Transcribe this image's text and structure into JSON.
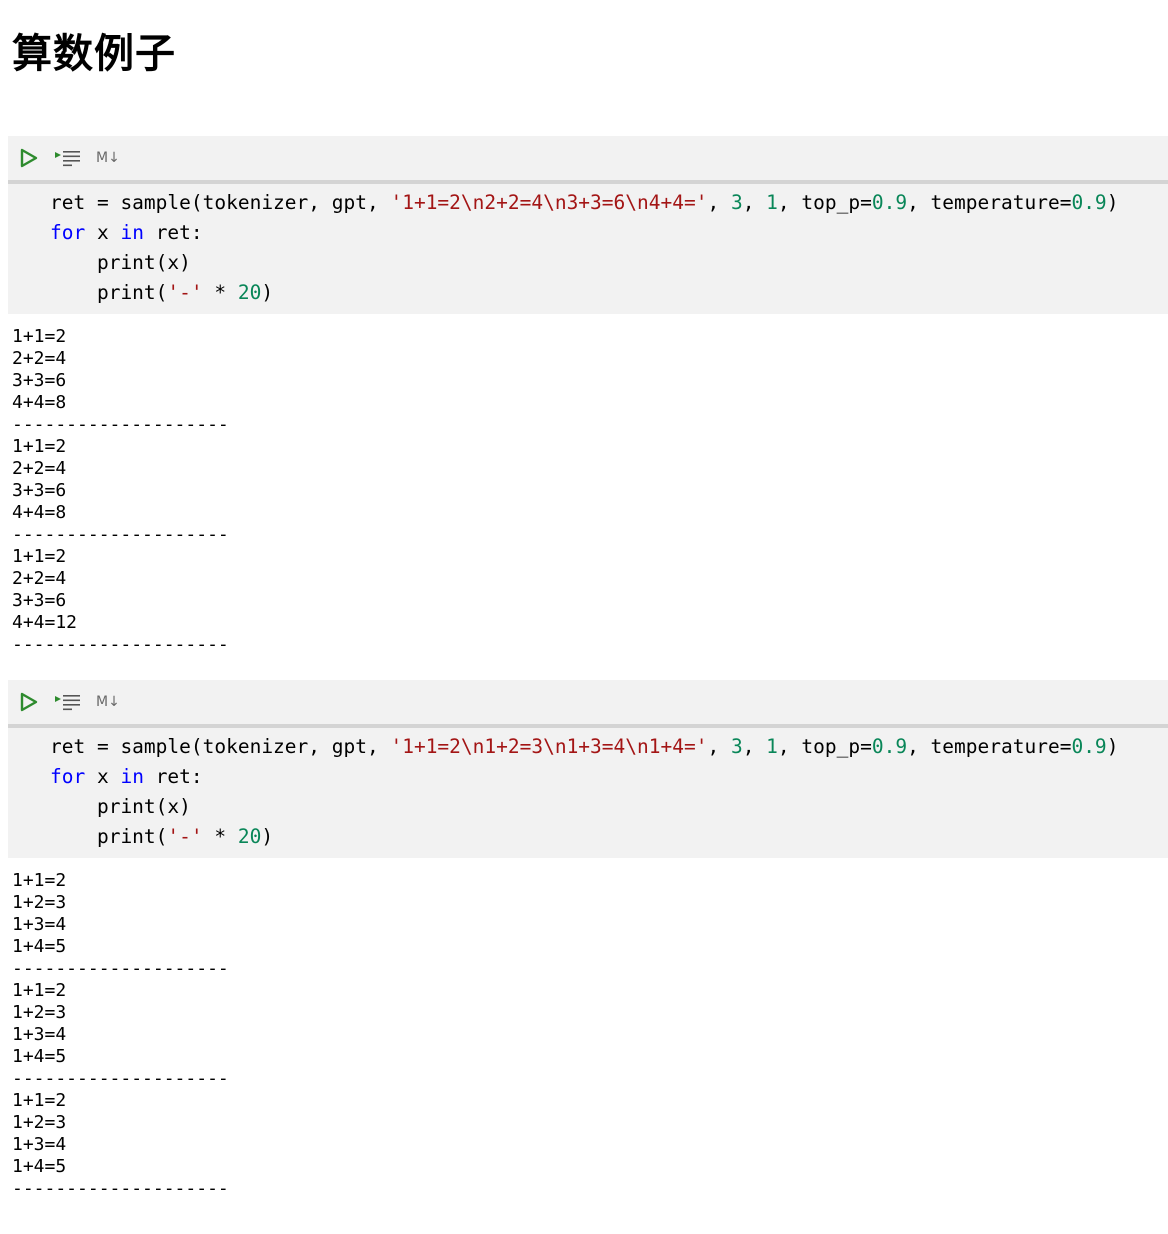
{
  "title": "算数例子",
  "toolbar": {
    "run_icon": "play-icon",
    "run_all_icon": "run-all-lines-icon",
    "markdown_label": "M↓",
    "icon_color": "#2e8b2e"
  },
  "cells": [
    {
      "code": {
        "l1_a": "ret = sample(tokenizer, gpt, ",
        "l1_str": "'1+1=2\\n2+2=4\\n3+3=6\\n4+4='",
        "l1_b": ", ",
        "l1_n1": "3",
        "l1_c": ", ",
        "l1_n2": "1",
        "l1_d": ", top_p=",
        "l1_n3": "0.9",
        "l1_e": ", temperature=",
        "l1_n4": "0.9",
        "l1_f": ")",
        "l2_kw1": "for",
        "l2_a": " x ",
        "l2_kw2": "in",
        "l2_b": " ret:",
        "l3": "    print(x)",
        "l4_a": "    print(",
        "l4_str": "'-'",
        "l4_b": " * ",
        "l4_num": "20",
        "l4_c": ")"
      },
      "output": "1+1=2\n2+2=4\n3+3=6\n4+4=8\n--------------------\n1+1=2\n2+2=4\n3+3=6\n4+4=8\n--------------------\n1+1=2\n2+2=4\n3+3=6\n4+4=12\n--------------------"
    },
    {
      "code": {
        "l1_a": "ret = sample(tokenizer, gpt, ",
        "l1_str": "'1+1=2\\n1+2=3\\n1+3=4\\n1+4='",
        "l1_b": ", ",
        "l1_n1": "3",
        "l1_c": ", ",
        "l1_n2": "1",
        "l1_d": ", top_p=",
        "l1_n3": "0.9",
        "l1_e": ", temperature=",
        "l1_n4": "0.9",
        "l1_f": ")",
        "l2_kw1": "for",
        "l2_a": " x ",
        "l2_kw2": "in",
        "l2_b": " ret:",
        "l3": "    print(x)",
        "l4_a": "    print(",
        "l4_str": "'-'",
        "l4_b": " * ",
        "l4_num": "20",
        "l4_c": ")"
      },
      "output": "1+1=2\n1+2=3\n1+3=4\n1+4=5\n--------------------\n1+1=2\n1+2=3\n1+3=4\n1+4=5\n--------------------\n1+1=2\n1+2=3\n1+3=4\n1+4=5\n--------------------"
    }
  ]
}
